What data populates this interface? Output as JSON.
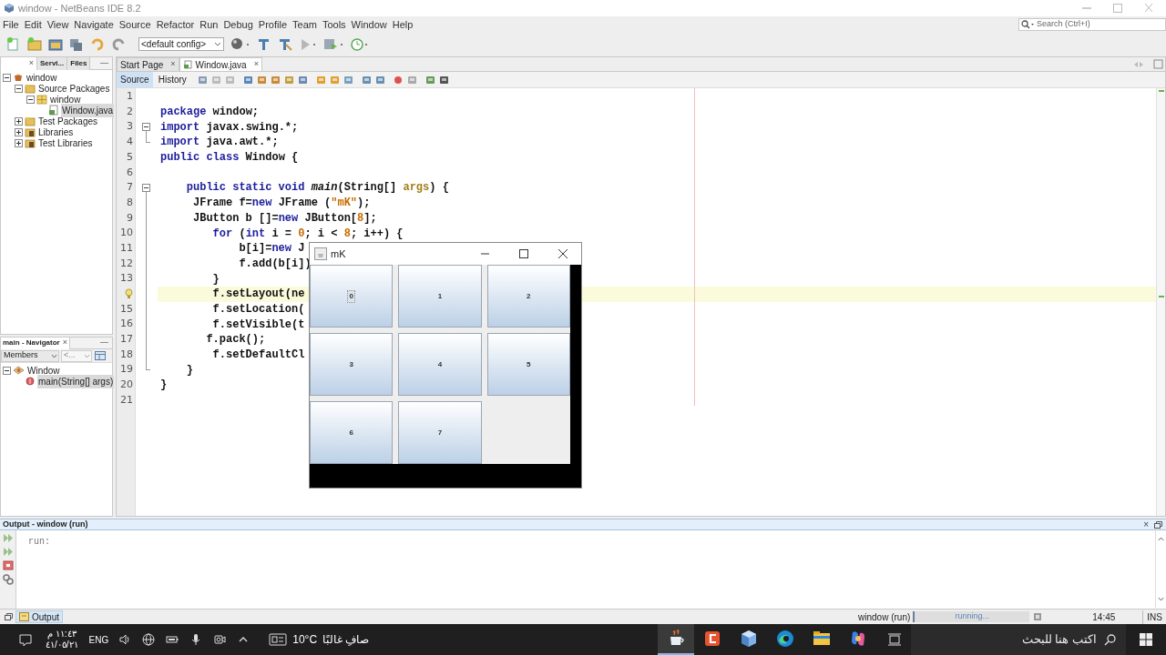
{
  "window": {
    "title": "window - NetBeans IDE 8.2"
  },
  "menu": [
    "File",
    "Edit",
    "View",
    "Navigate",
    "Source",
    "Refactor",
    "Run",
    "Debug",
    "Profile",
    "Team",
    "Tools",
    "Window",
    "Help"
  ],
  "search": {
    "placeholder": "Search (Ctrl+I)"
  },
  "toolbar": {
    "config": "<default config>"
  },
  "projects_panel": {
    "tabs": [
      {
        "close": "×",
        "selected": true
      },
      {
        "label": "Servi...",
        "selected": false
      },
      {
        "label": "Files",
        "selected": false
      }
    ],
    "minimize": "—",
    "tree": [
      {
        "label": "window",
        "kind": "project",
        "expanded": true,
        "selected": false,
        "children": [
          {
            "label": "Source Packages",
            "kind": "folder",
            "expanded": true,
            "selected": false,
            "children": [
              {
                "label": "window",
                "kind": "package",
                "expanded": true,
                "selected": false,
                "children": [
                  {
                    "label": "Window.java",
                    "kind": "file",
                    "selected": true
                  }
                ]
              }
            ]
          },
          {
            "label": "Test Packages",
            "kind": "folder",
            "expanded": false,
            "selected": false
          },
          {
            "label": "Libraries",
            "kind": "library",
            "expanded": false,
            "selected": false
          },
          {
            "label": "Test Libraries",
            "kind": "library",
            "expanded": false,
            "selected": false
          }
        ]
      }
    ]
  },
  "navigator": {
    "title": "main - Navigator",
    "close": "×",
    "minimize": "—",
    "filter": "Members",
    "dropdown": "<...",
    "tree": [
      {
        "label": "Window",
        "kind": "class",
        "expanded": true,
        "selected": false,
        "children": [
          {
            "label": "main(String[] args)",
            "kind": "method",
            "selected": true
          }
        ]
      }
    ]
  },
  "editor": {
    "tabs": [
      {
        "label": "Start Page",
        "close": "×",
        "selected": false
      },
      {
        "label": "Window.java",
        "close": "×",
        "selected": true
      }
    ],
    "views": [
      {
        "label": "Source",
        "selected": true
      },
      {
        "label": "History",
        "selected": false
      }
    ],
    "lines": [
      {
        "number": "1",
        "current": false,
        "hint": false,
        "foldable": false,
        "fold_end": false
      },
      {
        "number": "2",
        "current": false,
        "hint": false,
        "foldable": false,
        "fold_end": false,
        "tokens": [
          {
            "text": "package",
            "kind": "keyword"
          },
          {
            "text": " window;",
            "kind": "plain"
          }
        ]
      },
      {
        "number": "3",
        "current": false,
        "hint": false,
        "foldable": true,
        "fold_end": false,
        "tokens": [
          {
            "text": "import",
            "kind": "keyword"
          },
          {
            "text": " javax.swing.*;",
            "kind": "plain"
          }
        ]
      },
      {
        "number": "4",
        "current": false,
        "hint": false,
        "foldable": false,
        "fold_end": true,
        "tokens": [
          {
            "text": "import",
            "kind": "keyword"
          },
          {
            "text": " java.awt.*;",
            "kind": "plain"
          }
        ]
      },
      {
        "number": "5",
        "current": false,
        "hint": false,
        "foldable": false,
        "fold_end": false,
        "tokens": [
          {
            "text": "public class",
            "kind": "keyword"
          },
          {
            "text": " Window {",
            "kind": "plain"
          }
        ]
      },
      {
        "number": "6",
        "current": false,
        "hint": false,
        "foldable": false,
        "fold_end": false
      },
      {
        "number": "7",
        "current": false,
        "hint": false,
        "foldable": true,
        "fold_end": false,
        "tokens": [
          {
            "text": "    public static void ",
            "kind": "keyword"
          },
          {
            "text": "main",
            "kind": "method"
          },
          {
            "text": "(String[] ",
            "kind": "plain"
          },
          {
            "text": "args",
            "kind": "param"
          },
          {
            "text": ") {",
            "kind": "plain"
          }
        ]
      },
      {
        "number": "8",
        "current": false,
        "hint": false,
        "foldable": false,
        "fold_end": false,
        "tokens": [
          {
            "text": "     JFrame f=",
            "kind": "plain"
          },
          {
            "text": "new",
            "kind": "keyword"
          },
          {
            "text": " JFrame (",
            "kind": "plain"
          },
          {
            "text": "\"mK\"",
            "kind": "literal"
          },
          {
            "text": ");",
            "kind": "plain"
          }
        ]
      },
      {
        "number": "9",
        "current": false,
        "hint": false,
        "foldable": false,
        "fold_end": false,
        "tokens": [
          {
            "text": "     JButton b []=",
            "kind": "plain"
          },
          {
            "text": "new",
            "kind": "keyword"
          },
          {
            "text": " JButton[",
            "kind": "plain"
          },
          {
            "text": "8",
            "kind": "literal"
          },
          {
            "text": "];",
            "kind": "plain"
          }
        ]
      },
      {
        "number": "10",
        "current": false,
        "hint": false,
        "foldable": false,
        "fold_end": false,
        "tokens": [
          {
            "text": "        for",
            "kind": "keyword"
          },
          {
            "text": " (",
            "kind": "plain"
          },
          {
            "text": "int",
            "kind": "keyword"
          },
          {
            "text": " i = ",
            "kind": "plain"
          },
          {
            "text": "0",
            "kind": "literal"
          },
          {
            "text": "; i < ",
            "kind": "plain"
          },
          {
            "text": "8",
            "kind": "literal"
          },
          {
            "text": "; i++) {",
            "kind": "plain"
          }
        ]
      },
      {
        "number": "11",
        "current": false,
        "hint": false,
        "foldable": false,
        "fold_end": false,
        "tokens": [
          {
            "text": "            b[i]=",
            "kind": "plain"
          },
          {
            "text": "new",
            "kind": "keyword"
          },
          {
            "text": " J",
            "kind": "plain"
          }
        ]
      },
      {
        "number": "12",
        "current": false,
        "hint": false,
        "foldable": false,
        "fold_end": false,
        "tokens": [
          {
            "text": "            f.add(b[i])",
            "kind": "plain"
          }
        ]
      },
      {
        "number": "13",
        "current": false,
        "hint": false,
        "foldable": false,
        "fold_end": false,
        "tokens": [
          {
            "text": "        }",
            "kind": "plain"
          }
        ]
      },
      {
        "current": true,
        "hint": true,
        "foldable": false,
        "fold_end": false,
        "tokens": [
          {
            "text": "        f.setLayout(ne",
            "kind": "plain"
          }
        ]
      },
      {
        "number": "15",
        "current": false,
        "hint": false,
        "foldable": false,
        "fold_end": false,
        "tokens": [
          {
            "text": "        f.setLocation(",
            "kind": "plain"
          }
        ]
      },
      {
        "number": "16",
        "current": false,
        "hint": false,
        "foldable": false,
        "fold_end": false,
        "tokens": [
          {
            "text": "        f.setVisible(t",
            "kind": "plain"
          }
        ]
      },
      {
        "number": "17",
        "current": false,
        "hint": false,
        "foldable": false,
        "fold_end": false,
        "tokens": [
          {
            "text": "       f.pack();",
            "kind": "plain"
          }
        ]
      },
      {
        "number": "18",
        "current": false,
        "hint": false,
        "foldable": false,
        "fold_end": false,
        "tokens": [
          {
            "text": "        f.setDefaultCl",
            "kind": "plain"
          }
        ]
      },
      {
        "number": "19",
        "current": false,
        "hint": false,
        "foldable": false,
        "fold_end": true,
        "tokens": [
          {
            "text": "    }",
            "kind": "plain"
          }
        ]
      },
      {
        "number": "20",
        "current": false,
        "hint": false,
        "foldable": false,
        "fold_end": false,
        "tokens": [
          {
            "text": "}",
            "kind": "plain"
          }
        ]
      },
      {
        "number": "21",
        "current": false,
        "hint": false,
        "foldable": false,
        "fold_end": false
      }
    ]
  },
  "app_window": {
    "title": "mK",
    "buttons": [
      {
        "label": "0",
        "focused": true
      },
      {
        "label": "1",
        "focused": false
      },
      {
        "label": "2",
        "focused": false
      },
      {
        "label": "3",
        "focused": false
      },
      {
        "label": "4",
        "focused": false
      },
      {
        "label": "5",
        "focused": false
      },
      {
        "label": "6",
        "focused": false
      },
      {
        "label": "7",
        "focused": false
      }
    ]
  },
  "output": {
    "title": "Output - window (run)",
    "close": "×",
    "text": "run:",
    "tab": "Output"
  },
  "status_bar": {
    "task": "window (run)",
    "progress": "running...",
    "time": "14:45",
    "mode": "INS"
  },
  "taskbar": {
    "time": "١١:٤٣ م",
    "date": "٤١/٠٥/٢١",
    "language": "ENG",
    "temperature": "10°C",
    "weather": "صافِ غالبًا",
    "search_placeholder": "اكتب هنا للبحث",
    "apps": [
      {
        "kind": "java",
        "selected": true
      },
      {
        "kind": "c",
        "selected": false
      },
      {
        "kind": "cube",
        "selected": false
      },
      {
        "kind": "edge",
        "selected": false
      },
      {
        "kind": "folder",
        "selected": false
      },
      {
        "kind": "copilot",
        "selected": false
      }
    ]
  }
}
